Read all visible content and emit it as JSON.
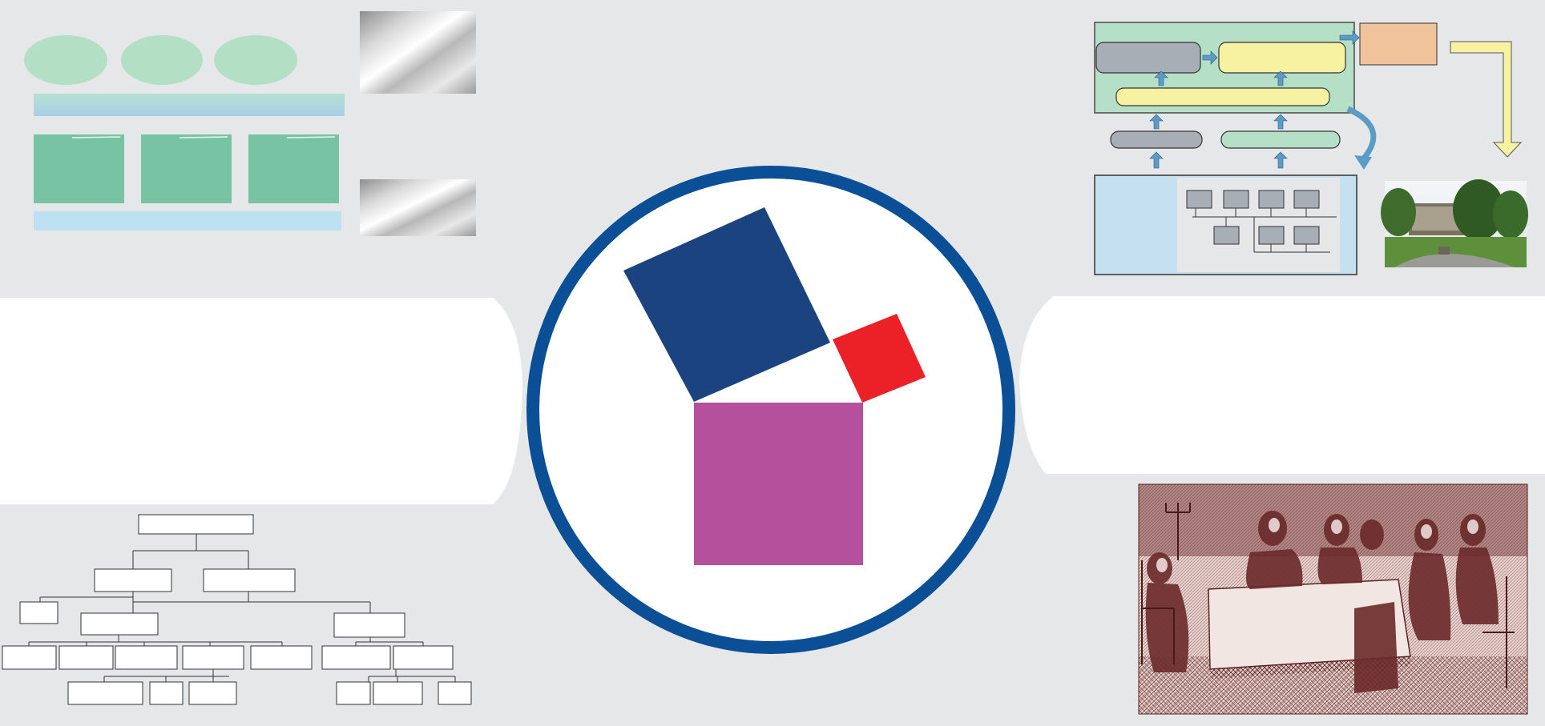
{
  "colors": {
    "background": "#e6e7e8",
    "panel": "#ffffff",
    "circle_ring": "#0b4f96",
    "square_hypotenuse": "#1a4380",
    "square_small": "#ec2127",
    "square_bottom": "#b5509c",
    "mint_light": "#b3dfc5",
    "mint_dark": "#78c3a3",
    "blue_band": "#bde0f3",
    "diagram_green": "#b5dfc6",
    "diagram_yellow": "#f6f2a2",
    "diagram_gray": "#a8aeb6",
    "diagram_orange": "#f0c39a",
    "diagram_blue": "#c5e0ef",
    "arrow_blue": "#5b9cc7",
    "engraving_ink": "#6b2a2a",
    "engraving_paper": "#e8d6d2"
  },
  "center_logo": {
    "icon": "pythagoras-squares-icon"
  },
  "images": {
    "metal_gradient_icon": "metal-gradient-icon",
    "building_photo_icon": "building-photo-icon",
    "engraving_icon": "historical-engraving-icon"
  },
  "org_chart": {
    "levels": 4
  }
}
